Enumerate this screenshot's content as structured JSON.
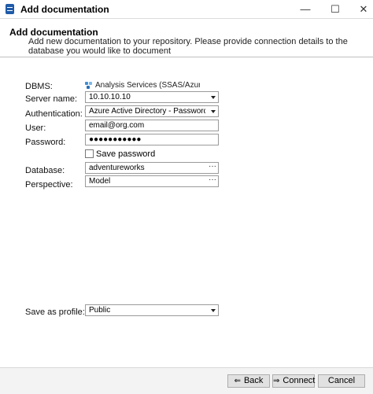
{
  "window": {
    "title": "Add documentation",
    "minimize": "—",
    "maximize": "☐",
    "close": "✕"
  },
  "header": {
    "title": "Add documentation",
    "description": "Add new documentation to your repository. Please provide connection details to the database you would like to document"
  },
  "form": {
    "dbms": {
      "label": "DBMS:",
      "value": "Analysis Services (SSAS/Azure) Tabular"
    },
    "server_name": {
      "label": "Server name:",
      "value": "10.10.10.10"
    },
    "authentication": {
      "label": "Authentication:",
      "value": "Azure Active Directory - Password"
    },
    "user": {
      "label": "User:",
      "value": "email@org.com"
    },
    "password": {
      "label": "Password:",
      "value": "●●●●●●●●●●●"
    },
    "save_password": {
      "label": "Save password",
      "checked": false
    },
    "database": {
      "label": "Database:",
      "value": "adventureworks",
      "browse": "···"
    },
    "perspective": {
      "label": "Perspective:",
      "value": "Model",
      "browse": "···"
    },
    "save_as_profile": {
      "label": "Save as profile:",
      "value": "Public"
    }
  },
  "footer": {
    "back_label": "Back",
    "back_arrow": "⇐",
    "connect_label": "Connect",
    "connect_arrow": "⇒",
    "cancel_label": "Cancel"
  }
}
